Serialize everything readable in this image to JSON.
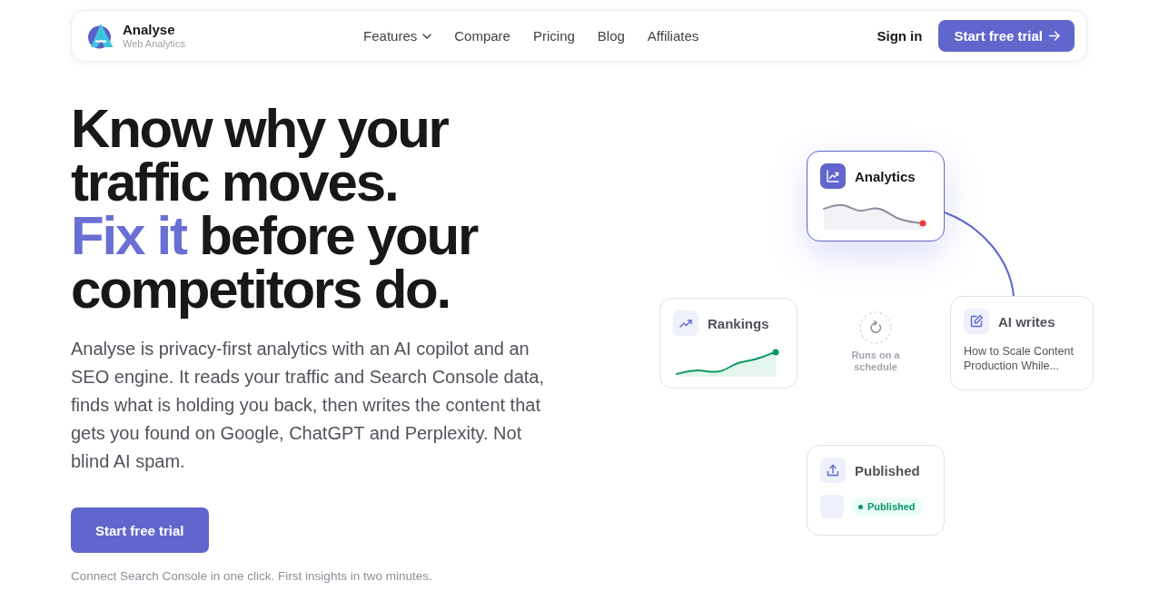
{
  "header": {
    "brand": {
      "name": "Analyse",
      "tagline": "Web Analytics"
    },
    "nav": [
      {
        "label": "Features",
        "kind": "dropdown"
      },
      {
        "label": "Compare",
        "kind": "link"
      },
      {
        "label": "Pricing",
        "kind": "link"
      },
      {
        "label": "Blog",
        "kind": "link"
      },
      {
        "label": "Affiliates",
        "kind": "link"
      }
    ],
    "sign_in": "Sign in",
    "cta": "Start free trial"
  },
  "hero": {
    "headline": [
      [
        {
          "text": "Know why your traffic moves.",
          "accent": false
        }
      ],
      [
        {
          "text": "Fix it",
          "accent": true
        },
        {
          "text": "before your competitors do.",
          "accent": false
        }
      ]
    ],
    "description": "Analyse is privacy-first analytics with an AI copilot and an SEO engine. It reads your traffic and Search Console data, finds what is holding you back, then writes the content that gets you found on Google, ChatGPT and Perplexity. Not blind AI spam.",
    "cta": "Start free trial",
    "note": "Connect Search Console in one click. First insights in two minutes."
  },
  "workflow": {
    "cards": [
      {
        "kind": "chart",
        "title": "Analytics",
        "active": true,
        "rising": false
      },
      {
        "kind": "chart",
        "title": "Rankings",
        "active": false,
        "rising": true
      },
      {
        "kind": "text",
        "title": "AI writes",
        "active": false,
        "text": "How to Scale Content Production While..."
      },
      {
        "kind": "status",
        "title": "Published",
        "active": false,
        "status": "Published"
      }
    ],
    "schedule": "Runs on a schedule"
  }
}
